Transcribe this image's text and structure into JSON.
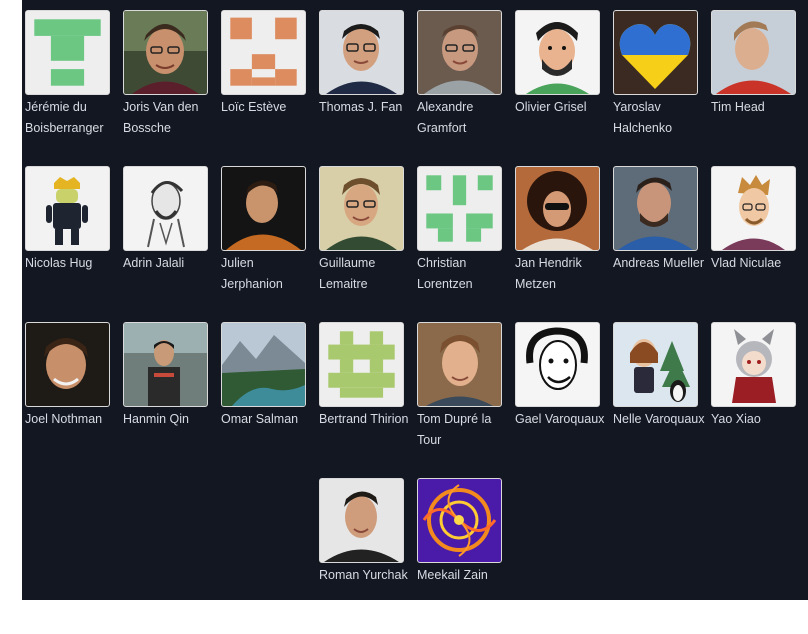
{
  "people": [
    {
      "name": "Jérémie du Boisberranger",
      "avatar": "identicon-green-avatar"
    },
    {
      "name": "Joris Van den Bossche",
      "avatar": "photo-avatar"
    },
    {
      "name": "Loïc Estève",
      "avatar": "identicon-orange-avatar"
    },
    {
      "name": "Thomas J. Fan",
      "avatar": "photo-avatar"
    },
    {
      "name": "Alexandre Gramfort",
      "avatar": "photo-avatar"
    },
    {
      "name": "Olivier Grisel",
      "avatar": "cartoon-avatar"
    },
    {
      "name": "Yaroslav Halchenko",
      "avatar": "ukraine-heart-avatar"
    },
    {
      "name": "Tim Head",
      "avatar": "photo-avatar"
    },
    {
      "name": "Nicolas Hug",
      "avatar": "android-figure-avatar"
    },
    {
      "name": "Adrin Jalali",
      "avatar": "sketch-avatar"
    },
    {
      "name": "Julien Jerphanion",
      "avatar": "photo-avatar"
    },
    {
      "name": "Guillaume Lemaitre",
      "avatar": "photo-avatar"
    },
    {
      "name": "Christian Lorentzen",
      "avatar": "identicon-green-avatar"
    },
    {
      "name": "Jan Hendrik Metzen",
      "avatar": "photo-avatar"
    },
    {
      "name": "Andreas Mueller",
      "avatar": "photo-avatar"
    },
    {
      "name": "Vlad Niculae",
      "avatar": "cartoon-avatar"
    },
    {
      "name": "Joel Nothman",
      "avatar": "photo-avatar"
    },
    {
      "name": "Hanmin Qin",
      "avatar": "photo-avatar"
    },
    {
      "name": "Omar Salman",
      "avatar": "landscape-avatar"
    },
    {
      "name": "Bertrand Thirion",
      "avatar": "identicon-olive-avatar"
    },
    {
      "name": "Tom Dupré la Tour",
      "avatar": "photo-avatar"
    },
    {
      "name": "Gael Varoquaux",
      "avatar": "sketch-avatar"
    },
    {
      "name": "Nelle Varoquaux",
      "avatar": "cartoon-avatar"
    },
    {
      "name": "Yao Xiao",
      "avatar": "anime-avatar"
    },
    {
      "name": "Roman Yurchak",
      "avatar": "photo-avatar"
    },
    {
      "name": "Meekail Zain",
      "avatar": "fractal-avatar"
    }
  ],
  "colors": {
    "page_background": "#131722",
    "name_text": "#d7dbe2",
    "identicon_green": "#6cc783",
    "identicon_orange": "#dd8c60",
    "identicon_olive": "#a9c96e"
  }
}
